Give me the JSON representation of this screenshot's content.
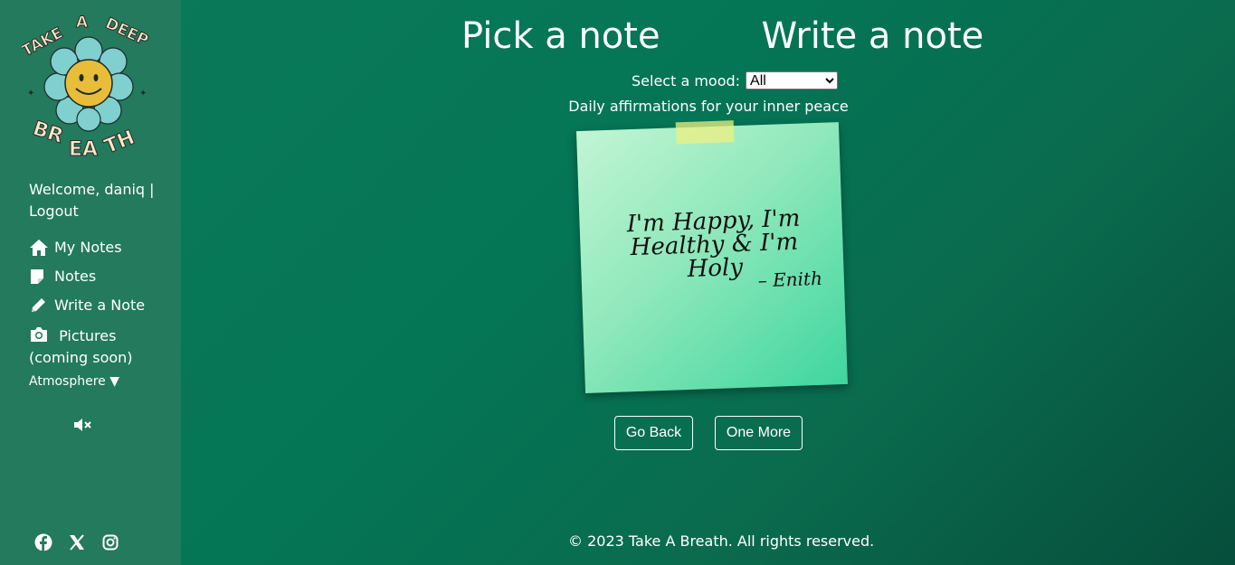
{
  "sidebar": {
    "logo_text": "TAKE A DEEP BREATH",
    "welcome": "Welcome, daniq |",
    "logout": "Logout",
    "nav": [
      {
        "label": "My Notes",
        "icon": "home-icon"
      },
      {
        "label": "Notes",
        "icon": "sticky-note-icon"
      },
      {
        "label": "Write a Note",
        "icon": "pencil-icon"
      },
      {
        "label": "Pictures (coming soon)",
        "icon": "camera-icon"
      }
    ],
    "atmosphere": "Atmosphere ▼",
    "mute_icon": "volume-mute-icon",
    "social": [
      "facebook-icon",
      "x-icon",
      "instagram-icon"
    ]
  },
  "tabs": {
    "pick": "Pick a note",
    "write": "Write a note"
  },
  "mood": {
    "label": "Select a mood:",
    "selected": "All"
  },
  "subtitle": "Daily affirmations for your inner peace",
  "note": {
    "text": "I'm Happy, I'm Healthy & I'm Holy",
    "author": "– Enith"
  },
  "buttons": {
    "back": "Go Back",
    "more": "One More"
  },
  "footer": "© 2023 Take A Breath. All rights reserved.",
  "colors": {
    "sidebar": "#237a5c",
    "background": "#047555",
    "note": "#8fe8bb"
  }
}
